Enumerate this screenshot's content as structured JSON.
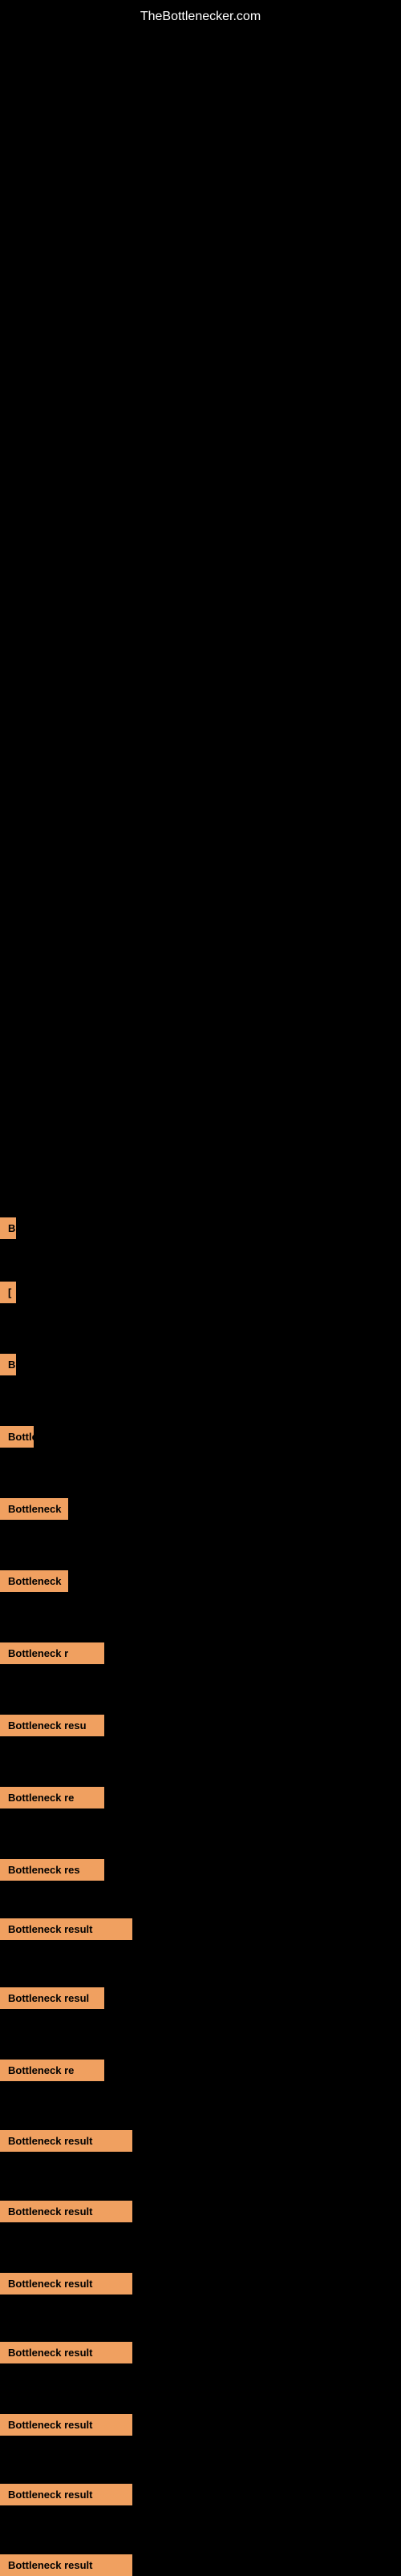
{
  "site": {
    "title": "TheBottlenecker.com"
  },
  "colors": {
    "background": "#000000",
    "badge_bg": "#f0a060",
    "badge_text": "#000000",
    "site_title": "#ffffff"
  },
  "results": [
    {
      "id": 1,
      "label": "B",
      "size": "tiny"
    },
    {
      "id": 2,
      "label": "[",
      "size": "tiny"
    },
    {
      "id": 3,
      "label": "B",
      "size": "tiny"
    },
    {
      "id": 4,
      "label": "Bottle",
      "size": "small"
    },
    {
      "id": 5,
      "label": "Bottleneck",
      "size": "medium"
    },
    {
      "id": 6,
      "label": "Bottleneck",
      "size": "medium"
    },
    {
      "id": 7,
      "label": "Bottleneck r",
      "size": "normal"
    },
    {
      "id": 8,
      "label": "Bottleneck resu",
      "size": "normal"
    },
    {
      "id": 9,
      "label": "Bottleneck re",
      "size": "normal"
    },
    {
      "id": 10,
      "label": "Bottleneck res",
      "size": "normal"
    },
    {
      "id": 11,
      "label": "Bottleneck result",
      "size": "full"
    },
    {
      "id": 12,
      "label": "Bottleneck resul",
      "size": "normal"
    },
    {
      "id": 13,
      "label": "Bottleneck re",
      "size": "normal"
    },
    {
      "id": 14,
      "label": "Bottleneck result",
      "size": "full"
    },
    {
      "id": 15,
      "label": "Bottleneck result",
      "size": "full"
    },
    {
      "id": 16,
      "label": "Bottleneck result",
      "size": "full"
    },
    {
      "id": 17,
      "label": "Bottleneck result",
      "size": "full"
    },
    {
      "id": 18,
      "label": "Bottleneck result",
      "size": "full"
    },
    {
      "id": 19,
      "label": "Bottleneck result",
      "size": "full"
    },
    {
      "id": 20,
      "label": "Bottleneck result",
      "size": "full"
    }
  ]
}
